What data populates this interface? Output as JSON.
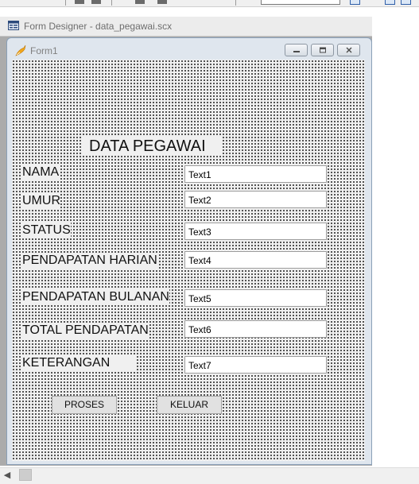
{
  "designer": {
    "title": "Form Designer - data_pegawai.scx"
  },
  "form": {
    "title": "Form1",
    "heading": "DATA PEGAWAI",
    "fields": [
      {
        "label": "NAMA",
        "value": "Text1"
      },
      {
        "label": "UMUR",
        "value": "Text2"
      },
      {
        "label": "STATUS",
        "value": "Text3"
      },
      {
        "label": "PENDAPATAN HARIAN",
        "value": "Text4"
      },
      {
        "label": "PENDAPATAN BULANAN",
        "value": "Text5"
      },
      {
        "label": "TOTAL PENDAPATAN",
        "value": "Text6"
      },
      {
        "label": "KETERANGAN",
        "value": "Text7"
      }
    ],
    "buttons": {
      "proses": "PROSES",
      "keluar": "KELUAR"
    }
  },
  "icons": {
    "designer": "form-designer-icon",
    "form": "fox-icon",
    "minimize": "minimize-icon",
    "maximize": "maximize-icon",
    "close": "close-icon",
    "scroll_left": "chevron-left-icon"
  },
  "colors": {
    "design_surface": "#f0f0f0",
    "grid_dots": "#2a2a2a",
    "window_frame": "#dfe6ee"
  }
}
